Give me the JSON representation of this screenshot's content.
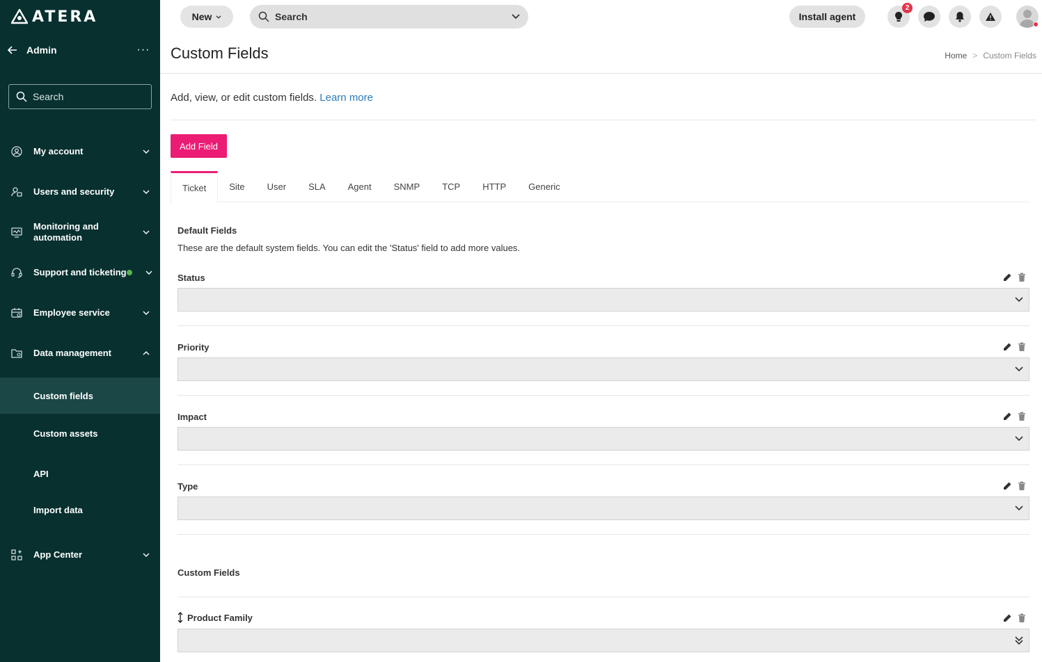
{
  "brand": {
    "logo_text": "ATERA"
  },
  "sidebar": {
    "header": {
      "label": "Admin",
      "more": "···"
    },
    "search_placeholder": "Search",
    "items": [
      {
        "label": "My account",
        "icon": "user-circle-icon"
      },
      {
        "label": "Users and security",
        "icon": "users-security-icon"
      },
      {
        "label": "Monitoring and automation",
        "icon": "monitor-icon"
      },
      {
        "label": "Support and ticketing",
        "icon": "headset-icon",
        "status_dot": true
      },
      {
        "label": "Employee service",
        "icon": "employee-service-icon"
      },
      {
        "label": "Data management",
        "icon": "folder-settings-icon",
        "expanded": true
      },
      {
        "label": "App Center",
        "icon": "apps-icon"
      }
    ],
    "subitems": [
      {
        "label": "Custom fields",
        "active": true
      },
      {
        "label": "Custom assets"
      },
      {
        "label": "API"
      },
      {
        "label": "Import data"
      }
    ]
  },
  "topbar": {
    "new_label": "New",
    "search_label": "Search",
    "install_label": "Install agent",
    "notifications_badge": "2"
  },
  "page": {
    "title": "Custom Fields",
    "breadcrumb": {
      "home": "Home",
      "sep": ">",
      "current": "Custom Fields"
    },
    "description": "Add, view, or edit custom fields.",
    "learn_more": "Learn more",
    "add_field_label": "Add Field",
    "tabs": [
      "Ticket",
      "Site",
      "User",
      "SLA",
      "Agent",
      "SNMP",
      "TCP",
      "HTTP",
      "Generic"
    ],
    "active_tab": "Ticket",
    "default_title": "Default Fields",
    "default_desc": "These are the default system fields. You can edit the 'Status' field to add more values.",
    "default_fields": [
      "Status",
      "Priority",
      "Impact",
      "Type"
    ],
    "custom_title": "Custom Fields",
    "custom_fields": [
      "Product Family"
    ]
  },
  "colors": {
    "sidebar_bg": "#07302f",
    "accent": "#ec1c74",
    "link": "#2b7bb9"
  }
}
